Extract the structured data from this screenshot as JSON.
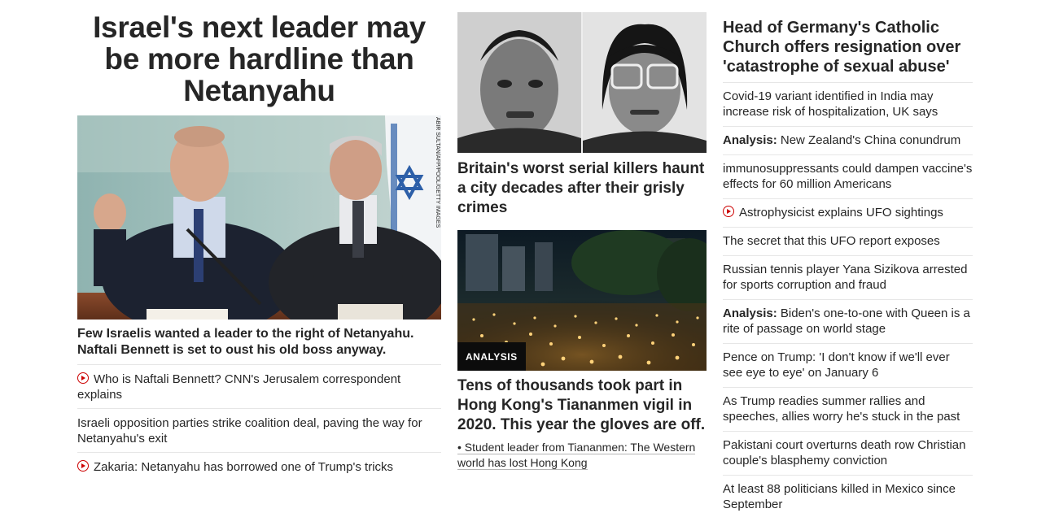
{
  "lead": {
    "headline": "Israel's next leader may be more hardline than Netanyahu",
    "photo_credit": "ABIR SULTAN/AFP/POOL/GETTY IMAGES",
    "caption": "Few Israelis wanted a leader to the right of Netanyahu. Naftali Bennett is set to oust his old boss anyway.",
    "links": [
      {
        "text": "Who is Naftali Bennett? CNN's Jerusalem correspondent explains",
        "video": true
      },
      {
        "text": "Israeli opposition parties strike coalition deal, paving the way for Netanyahu's exit",
        "video": false
      },
      {
        "text": "Zakaria: Netanyahu has borrowed one of Trump's tricks",
        "video": true
      }
    ]
  },
  "middle": {
    "story1": {
      "title": "Britain's worst serial killers haunt a city decades after their grisly crimes"
    },
    "story2": {
      "badge": "ANALYSIS",
      "title": "Tens of thousands took part in Hong Kong's Tiananmen vigil in 2020. This year the gloves are off.",
      "related": "• Student leader from Tiananmen: The Western world has lost Hong Kong"
    }
  },
  "right": {
    "headline": "Head of Germany's Catholic Church offers resignation over 'catastrophe of sexual abuse'",
    "links": [
      {
        "prefix": "",
        "text": "Covid-19 variant identified in India may increase risk of hospitalization, UK says",
        "video": false
      },
      {
        "prefix": "Analysis:",
        "text": " New Zealand's China conundrum",
        "video": false
      },
      {
        "prefix": "",
        "text": "immunosuppressants could dampen vaccine's effects for 60 million Americans",
        "video": false
      },
      {
        "prefix": "",
        "text": "Astrophysicist explains UFO sightings",
        "video": true
      },
      {
        "prefix": "",
        "text": "The secret that this UFO report exposes",
        "video": false
      },
      {
        "prefix": "",
        "text": "Russian tennis player Yana Sizikova arrested for sports corruption and fraud",
        "video": false
      },
      {
        "prefix": "Analysis:",
        "text": " Biden's one-to-one with Queen is a rite of passage on world stage",
        "video": false
      },
      {
        "prefix": "",
        "text": "Pence on Trump: 'I don't know if we'll ever see eye to eye' on January 6",
        "video": false
      },
      {
        "prefix": "",
        "text": "As Trump readies summer rallies and speeches, allies worry he's stuck in the past",
        "video": false
      },
      {
        "prefix": "",
        "text": "Pakistani court overturns death row Christian couple's blasphemy conviction",
        "video": false
      },
      {
        "prefix": "",
        "text": "At least 88 politicians killed in Mexico since September",
        "video": false
      }
    ]
  },
  "colors": {
    "video_red": "#cc0000",
    "text": "#262626",
    "divider": "#e6e6e6"
  },
  "icons": {
    "video": "play-circle-icon"
  }
}
